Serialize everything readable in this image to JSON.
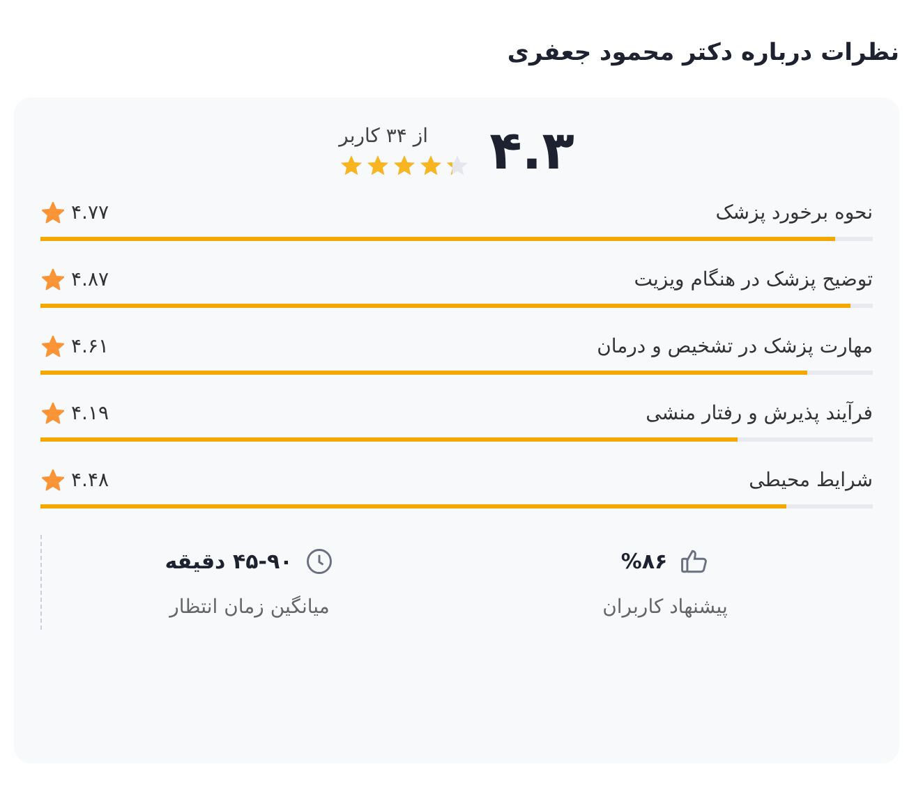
{
  "title": "نظرات درباره دکتر محمود جعفری",
  "summary": {
    "score": "۴.۳",
    "count": "از ۳۴ کاربر",
    "stars": 4.3
  },
  "criteria": [
    {
      "label": "نحوه برخورد پزشک",
      "value": "۴.۷۷",
      "level": 0.954
    },
    {
      "label": "توضیح پزشک در هنگام ویزیت",
      "value": "۴.۸۷",
      "level": 0.974
    },
    {
      "label": "مهارت پزشک در تشخیص و درمان",
      "value": "۴.۶۱",
      "level": 0.922
    },
    {
      "label": "فرآیند پذیرش و رفتار منشی",
      "value": "۴.۱۹",
      "level": 0.838
    },
    {
      "label": "شرایط محیطی",
      "value": "۴.۴۸",
      "level": 0.896
    }
  ],
  "stats": [
    {
      "kind": "recommend",
      "value": "%۸۶",
      "label": "پیشنهاد کاربران"
    },
    {
      "kind": "wait",
      "value": "۴۵-۹۰ دقیقه",
      "label": "میانگین زمان انتظار"
    }
  ]
}
